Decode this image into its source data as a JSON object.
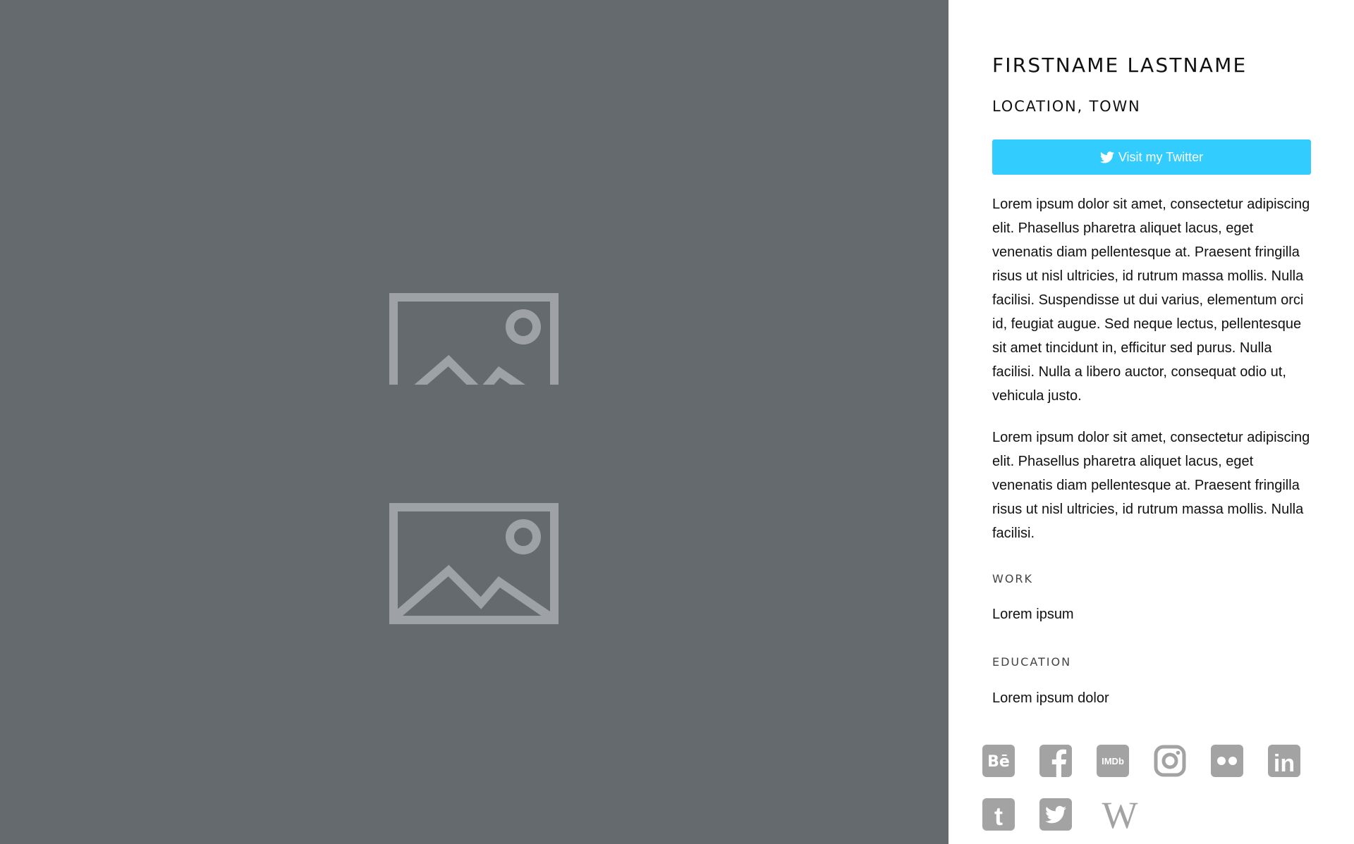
{
  "profile": {
    "name": "FIRSTNAME LASTNAME",
    "location": "LOCATION, TOWN",
    "twitter_button_label": "Visit my Twitter"
  },
  "bio": {
    "paragraph_1": "Lorem ipsum dolor sit amet, consectetur adipiscing elit. Phasellus pharetra aliquet lacus, eget venenatis diam pellentesque at. Praesent fringilla risus ut nisl ultricies, id rutrum massa mollis. Nulla facilisi. Suspendisse ut dui varius, elementum orci id, feugiat augue. Sed neque lectus, pellentesque sit amet tincidunt in, efficitur sed purus. Nulla facilisi. Nulla a libero auctor, consequat odio ut, vehicula justo.",
    "paragraph_2": "Lorem ipsum dolor sit amet, consectetur adipiscing elit. Phasellus pharetra aliquet lacus, eget venenatis diam pellentesque at. Praesent fringilla risus ut nisl ultricies, id rutrum massa mollis. Nulla facilisi."
  },
  "work": {
    "label": "WORK",
    "value": "Lorem ipsum"
  },
  "education": {
    "label": "EDUCATION",
    "value": "Lorem ipsum dolor"
  },
  "images": [
    {
      "icon": "image-placeholder-icon"
    },
    {
      "icon": "image-placeholder-icon"
    }
  ],
  "social_links": [
    {
      "icon": "behance-icon",
      "glyph": "Bē"
    },
    {
      "icon": "facebook-icon",
      "glyph": "f"
    },
    {
      "icon": "imdb-icon",
      "glyph": "IMDb"
    },
    {
      "icon": "instagram-icon"
    },
    {
      "icon": "flickr-icon"
    },
    {
      "icon": "linkedin-icon",
      "glyph": "in"
    },
    {
      "icon": "tumblr-icon",
      "glyph": "t"
    },
    {
      "icon": "twitter-icon"
    },
    {
      "icon": "wikipedia-icon",
      "glyph": "W"
    }
  ],
  "colors": {
    "left_background": "#656a6e",
    "placeholder_icon": "#9ea2a6",
    "twitter_button": "#33ccff",
    "social_icon": "#a3a3a3",
    "text": "#111111"
  }
}
